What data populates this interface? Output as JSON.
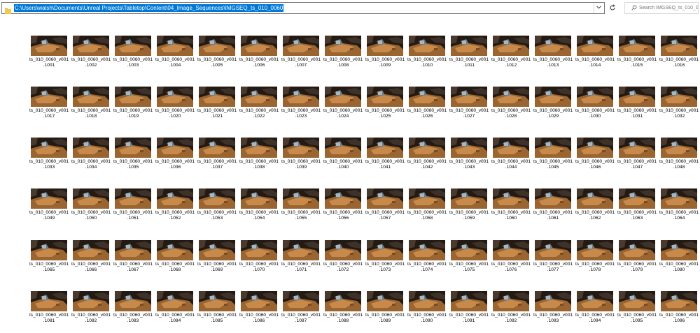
{
  "address_bar": {
    "path": "C:\\Users\\walsh\\Documents\\Unreal Projects\\Tabletop\\Content\\04_Image_Sequences\\IMGSEQ_ts_010_0060"
  },
  "search": {
    "placeholder": "Search IMGSEQ_ts_010_0060"
  },
  "icons": {
    "folder": "folder-icon",
    "dropdown": "chevron-down-icon",
    "refresh": "refresh-icon",
    "search": "search-icon"
  },
  "files": [
    {
      "name_line1": "ts_010_0060_v001",
      "name_line2": ".1001"
    },
    {
      "name_line1": "ts_010_0060_v001",
      "name_line2": ".1002"
    },
    {
      "name_line1": "ts_010_0060_v001",
      "name_line2": ".1003"
    },
    {
      "name_line1": "ts_010_0060_v001",
      "name_line2": ".1004"
    },
    {
      "name_line1": "ts_010_0060_v001",
      "name_line2": ".1005"
    },
    {
      "name_line1": "ts_010_0060_v001",
      "name_line2": ".1006"
    },
    {
      "name_line1": "ts_010_0060_v001",
      "name_line2": ".1007"
    },
    {
      "name_line1": "ts_010_0060_v001",
      "name_line2": ".1008"
    },
    {
      "name_line1": "ts_010_0060_v001",
      "name_line2": ".1009"
    },
    {
      "name_line1": "ts_010_0060_v001",
      "name_line2": ".1010"
    },
    {
      "name_line1": "ts_010_0060_v001",
      "name_line2": ".1011"
    },
    {
      "name_line1": "ts_010_0060_v001",
      "name_line2": ".1012"
    },
    {
      "name_line1": "ts_010_0060_v001",
      "name_line2": ".1013"
    },
    {
      "name_line1": "ts_010_0060_v001",
      "name_line2": ".1014"
    },
    {
      "name_line1": "ts_010_0060_v001",
      "name_line2": ".1015"
    },
    {
      "name_line1": "ts_010_0060_v001",
      "name_line2": ".1016"
    },
    {
      "name_line1": "ts_010_0060_v001",
      "name_line2": ".1017"
    },
    {
      "name_line1": "ts_010_0060_v001",
      "name_line2": ".1018"
    },
    {
      "name_line1": "ts_010_0060_v001",
      "name_line2": ".1019"
    },
    {
      "name_line1": "ts_010_0060_v001",
      "name_line2": ".1020"
    },
    {
      "name_line1": "ts_010_0060_v001",
      "name_line2": ".1021"
    },
    {
      "name_line1": "ts_010_0060_v001",
      "name_line2": ".1022"
    },
    {
      "name_line1": "ts_010_0060_v001",
      "name_line2": ".1023"
    },
    {
      "name_line1": "ts_010_0060_v001",
      "name_line2": ".1024"
    },
    {
      "name_line1": "ts_010_0060_v001",
      "name_line2": ".1025"
    },
    {
      "name_line1": "ts_010_0060_v001",
      "name_line2": ".1026"
    },
    {
      "name_line1": "ts_010_0060_v001",
      "name_line2": ".1027"
    },
    {
      "name_line1": "ts_010_0060_v001",
      "name_line2": ".1028"
    },
    {
      "name_line1": "ts_010_0060_v001",
      "name_line2": ".1029"
    },
    {
      "name_line1": "ts_010_0060_v001",
      "name_line2": ".1030"
    },
    {
      "name_line1": "ts_010_0060_v001",
      "name_line2": ".1031"
    },
    {
      "name_line1": "ts_010_0060_v001",
      "name_line2": ".1032"
    },
    {
      "name_line1": "ts_010_0060_v001",
      "name_line2": ".1033"
    },
    {
      "name_line1": "ts_010_0060_v001",
      "name_line2": ".1034"
    },
    {
      "name_line1": "ts_010_0060_v001",
      "name_line2": ".1035"
    },
    {
      "name_line1": "ts_010_0060_v001",
      "name_line2": ".1036"
    },
    {
      "name_line1": "ts_010_0060_v001",
      "name_line2": ".1037"
    },
    {
      "name_line1": "ts_010_0060_v001",
      "name_line2": ".1038"
    },
    {
      "name_line1": "ts_010_0060_v001",
      "name_line2": ".1039"
    },
    {
      "name_line1": "ts_010_0060_v001",
      "name_line2": ".1040"
    },
    {
      "name_line1": "ts_010_0060_v001",
      "name_line2": ".1041"
    },
    {
      "name_line1": "ts_010_0060_v001",
      "name_line2": ".1042"
    },
    {
      "name_line1": "ts_010_0060_v001",
      "name_line2": ".1043"
    },
    {
      "name_line1": "ts_010_0060_v001",
      "name_line2": ".1044"
    },
    {
      "name_line1": "ts_010_0060_v001",
      "name_line2": ".1045"
    },
    {
      "name_line1": "ts_010_0060_v001",
      "name_line2": ".1046"
    },
    {
      "name_line1": "ts_010_0060_v001",
      "name_line2": ".1047"
    },
    {
      "name_line1": "ts_010_0060_v001",
      "name_line2": ".1048"
    },
    {
      "name_line1": "ts_010_0060_v001",
      "name_line2": ".1049"
    },
    {
      "name_line1": "ts_010_0060_v001",
      "name_line2": ".1050"
    },
    {
      "name_line1": "ts_010_0060_v001",
      "name_line2": ".1051"
    },
    {
      "name_line1": "ts_010_0060_v001",
      "name_line2": ".1052"
    },
    {
      "name_line1": "ts_010_0060_v001",
      "name_line2": ".1053"
    },
    {
      "name_line1": "ts_010_0060_v001",
      "name_line2": ".1054"
    },
    {
      "name_line1": "ts_010_0060_v001",
      "name_line2": ".1055"
    },
    {
      "name_line1": "ts_010_0060_v001",
      "name_line2": ".1056"
    },
    {
      "name_line1": "ts_010_0060_v001",
      "name_line2": ".1057"
    },
    {
      "name_line1": "ts_010_0060_v001",
      "name_line2": ".1058"
    },
    {
      "name_line1": "ts_010_0060_v001",
      "name_line2": ".1059"
    },
    {
      "name_line1": "ts_010_0060_v001",
      "name_line2": ".1060"
    },
    {
      "name_line1": "ts_010_0060_v001",
      "name_line2": ".1061"
    },
    {
      "name_line1": "ts_010_0060_v001",
      "name_line2": ".1062"
    },
    {
      "name_line1": "ts_010_0060_v001",
      "name_line2": ".1063"
    },
    {
      "name_line1": "ts_010_0060_v001",
      "name_line2": ".1064"
    },
    {
      "name_line1": "ts_010_0060_v001",
      "name_line2": ".1065"
    },
    {
      "name_line1": "ts_010_0060_v001",
      "name_line2": ".1066"
    },
    {
      "name_line1": "ts_010_0060_v001",
      "name_line2": ".1067"
    },
    {
      "name_line1": "ts_010_0060_v001",
      "name_line2": ".1068"
    },
    {
      "name_line1": "ts_010_0060_v001",
      "name_line2": ".1069"
    },
    {
      "name_line1": "ts_010_0060_v001",
      "name_line2": ".1070"
    },
    {
      "name_line1": "ts_010_0060_v001",
      "name_line2": ".1071"
    },
    {
      "name_line1": "ts_010_0060_v001",
      "name_line2": ".1072"
    },
    {
      "name_line1": "ts_010_0060_v001",
      "name_line2": ".1073"
    },
    {
      "name_line1": "ts_010_0060_v001",
      "name_line2": ".1074"
    },
    {
      "name_line1": "ts_010_0060_v001",
      "name_line2": ".1075"
    },
    {
      "name_line1": "ts_010_0060_v001",
      "name_line2": ".1076"
    },
    {
      "name_line1": "ts_010_0060_v001",
      "name_line2": ".1077"
    },
    {
      "name_line1": "ts_010_0060_v001",
      "name_line2": ".1078"
    },
    {
      "name_line1": "ts_010_0060_v001",
      "name_line2": ".1079"
    },
    {
      "name_line1": "ts_010_0060_v001",
      "name_line2": ".1080"
    },
    {
      "name_line1": "ts_010_0060_v001",
      "name_line2": ".1081"
    },
    {
      "name_line1": "ts_010_0060_v001",
      "name_line2": ".1082"
    },
    {
      "name_line1": "ts_010_0060_v001",
      "name_line2": ".1083"
    },
    {
      "name_line1": "ts_010_0060_v001",
      "name_line2": ".1084"
    },
    {
      "name_line1": "ts_010_0060_v001",
      "name_line2": ".1085"
    },
    {
      "name_line1": "ts_010_0060_v001",
      "name_line2": ".1086"
    },
    {
      "name_line1": "ts_010_0060_v001",
      "name_line2": ".1087"
    },
    {
      "name_line1": "ts_010_0060_v001",
      "name_line2": ".1088"
    },
    {
      "name_line1": "ts_010_0060_v001",
      "name_line2": ".1089"
    },
    {
      "name_line1": "ts_010_0060_v001",
      "name_line2": ".1090"
    },
    {
      "name_line1": "ts_010_0060_v001",
      "name_line2": ".1091"
    },
    {
      "name_line1": "ts_010_0060_v001",
      "name_line2": ".1092"
    },
    {
      "name_line1": "ts_010_0060_v001",
      "name_line2": ".1093"
    },
    {
      "name_line1": "ts_010_0060_v001",
      "name_line2": ".1094"
    },
    {
      "name_line1": "ts_010_0060_v001",
      "name_line2": ".1095"
    },
    {
      "name_line1": "ts_010_0060_v001",
      "name_line2": ".1096"
    }
  ]
}
